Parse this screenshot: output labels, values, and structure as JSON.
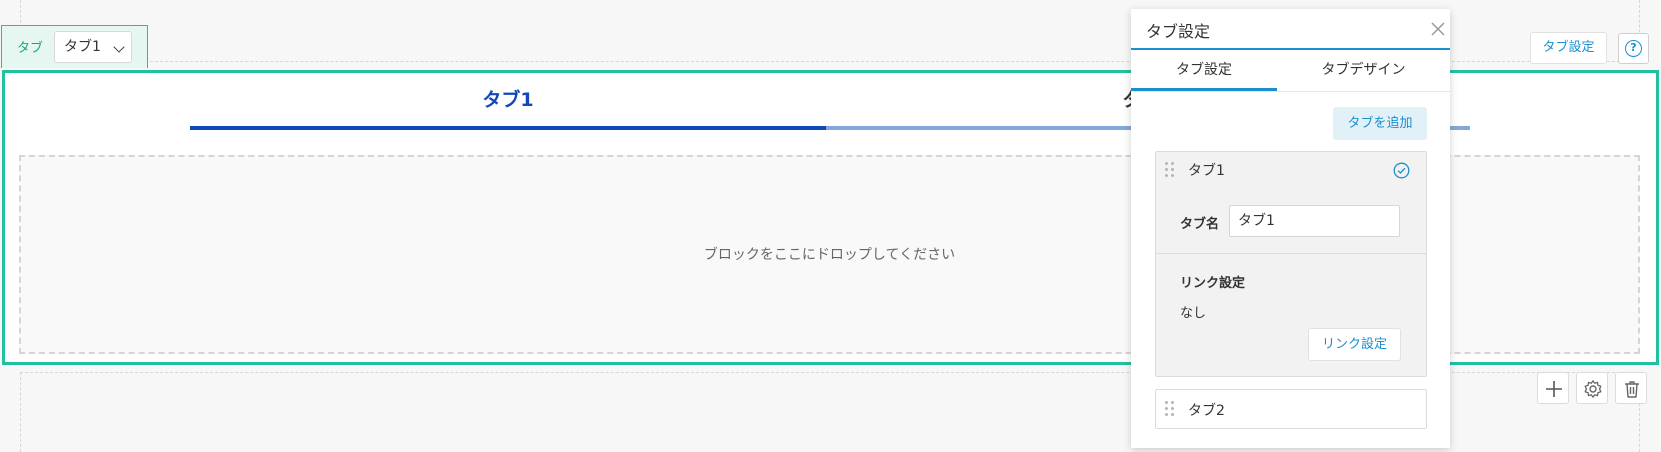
{
  "tab_selector": {
    "label": "タブ",
    "selected": "タブ1"
  },
  "block": {
    "tabs": [
      {
        "label": "タブ1",
        "active": true
      },
      {
        "label": "タブ2",
        "active": false
      }
    ],
    "drop_placeholder": "ブロックをここにドロップしてください"
  },
  "toolbar": {
    "tab_settings_label": "タブ設定",
    "help_icon": "help-icon",
    "actions": [
      "plus-icon",
      "gear-icon",
      "trash-icon"
    ]
  },
  "panel": {
    "title": "タブ設定",
    "tabs": [
      {
        "label": "タブ設定",
        "active": true
      },
      {
        "label": "タブデザイン",
        "active": false
      }
    ],
    "add_tab_label": "タブを追加",
    "items": [
      {
        "title": "タブ1",
        "expanded": true,
        "name_label": "タブ名",
        "name_value": "タブ1",
        "link_heading": "リンク設定",
        "link_value": "なし",
        "link_button": "リンク設定"
      },
      {
        "title": "タブ2",
        "expanded": false
      }
    ]
  },
  "colors": {
    "accent_green": "#22c19e",
    "tab_active_blue": "#1147b9",
    "tab_inactive_blue": "#85a6d9",
    "link_blue": "#1a8fd0"
  }
}
